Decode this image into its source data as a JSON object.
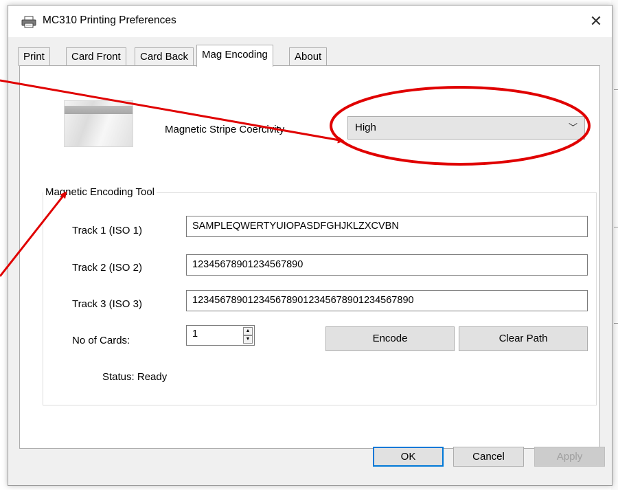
{
  "window": {
    "title": "MC310 Printing Preferences",
    "close_glyph": "✕"
  },
  "tabs": [
    {
      "label": "Print",
      "active": false
    },
    {
      "label": "Card Front",
      "active": false
    },
    {
      "label": "Card Back",
      "active": false
    },
    {
      "label": "Mag Encoding",
      "active": true
    },
    {
      "label": "About",
      "active": false
    }
  ],
  "coercivity": {
    "label": "Magnetic Stripe Coercivity",
    "selected": "High"
  },
  "encoding_tool": {
    "legend": "Magnetic Encoding Tool",
    "tracks": [
      {
        "label": "Track 1 (ISO 1)",
        "value": "SAMPLEQWERTYUIOPASDFGHJKLZXCVBN"
      },
      {
        "label": "Track 2 (ISO 2)",
        "value": "12345678901234567890"
      },
      {
        "label": "Track 3 (ISO 3)",
        "value": "12345678901234567890123456789012345678​90"
      }
    ],
    "cards_label": "No of Cards:",
    "cards_value": "1",
    "encode_label": "Encode",
    "clear_label": "Clear Path",
    "status": "Status: Ready"
  },
  "footer": {
    "ok": "OK",
    "cancel": "Cancel",
    "apply": "Apply"
  },
  "colors": {
    "annotation": "#e00000",
    "accent": "#0078d7"
  }
}
